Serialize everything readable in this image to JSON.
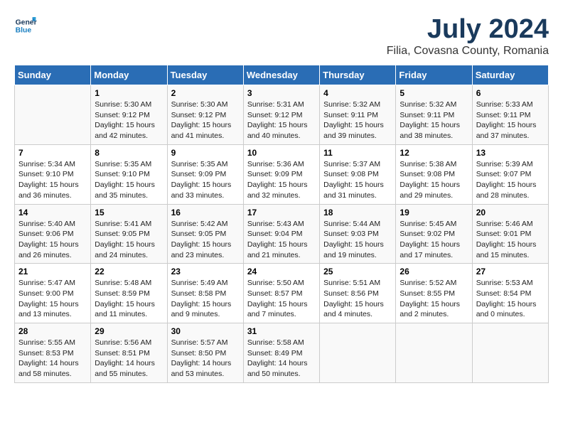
{
  "header": {
    "logo_line1": "General",
    "logo_line2": "Blue",
    "month_year": "July 2024",
    "location": "Filia, Covasna County, Romania"
  },
  "weekdays": [
    "Sunday",
    "Monday",
    "Tuesday",
    "Wednesday",
    "Thursday",
    "Friday",
    "Saturday"
  ],
  "weeks": [
    [
      {
        "day": "",
        "sunrise": "",
        "sunset": "",
        "daylight": ""
      },
      {
        "day": "1",
        "sunrise": "Sunrise: 5:30 AM",
        "sunset": "Sunset: 9:12 PM",
        "daylight": "Daylight: 15 hours and 42 minutes."
      },
      {
        "day": "2",
        "sunrise": "Sunrise: 5:30 AM",
        "sunset": "Sunset: 9:12 PM",
        "daylight": "Daylight: 15 hours and 41 minutes."
      },
      {
        "day": "3",
        "sunrise": "Sunrise: 5:31 AM",
        "sunset": "Sunset: 9:12 PM",
        "daylight": "Daylight: 15 hours and 40 minutes."
      },
      {
        "day": "4",
        "sunrise": "Sunrise: 5:32 AM",
        "sunset": "Sunset: 9:11 PM",
        "daylight": "Daylight: 15 hours and 39 minutes."
      },
      {
        "day": "5",
        "sunrise": "Sunrise: 5:32 AM",
        "sunset": "Sunset: 9:11 PM",
        "daylight": "Daylight: 15 hours and 38 minutes."
      },
      {
        "day": "6",
        "sunrise": "Sunrise: 5:33 AM",
        "sunset": "Sunset: 9:11 PM",
        "daylight": "Daylight: 15 hours and 37 minutes."
      }
    ],
    [
      {
        "day": "7",
        "sunrise": "Sunrise: 5:34 AM",
        "sunset": "Sunset: 9:10 PM",
        "daylight": "Daylight: 15 hours and 36 minutes."
      },
      {
        "day": "8",
        "sunrise": "Sunrise: 5:35 AM",
        "sunset": "Sunset: 9:10 PM",
        "daylight": "Daylight: 15 hours and 35 minutes."
      },
      {
        "day": "9",
        "sunrise": "Sunrise: 5:35 AM",
        "sunset": "Sunset: 9:09 PM",
        "daylight": "Daylight: 15 hours and 33 minutes."
      },
      {
        "day": "10",
        "sunrise": "Sunrise: 5:36 AM",
        "sunset": "Sunset: 9:09 PM",
        "daylight": "Daylight: 15 hours and 32 minutes."
      },
      {
        "day": "11",
        "sunrise": "Sunrise: 5:37 AM",
        "sunset": "Sunset: 9:08 PM",
        "daylight": "Daylight: 15 hours and 31 minutes."
      },
      {
        "day": "12",
        "sunrise": "Sunrise: 5:38 AM",
        "sunset": "Sunset: 9:08 PM",
        "daylight": "Daylight: 15 hours and 29 minutes."
      },
      {
        "day": "13",
        "sunrise": "Sunrise: 5:39 AM",
        "sunset": "Sunset: 9:07 PM",
        "daylight": "Daylight: 15 hours and 28 minutes."
      }
    ],
    [
      {
        "day": "14",
        "sunrise": "Sunrise: 5:40 AM",
        "sunset": "Sunset: 9:06 PM",
        "daylight": "Daylight: 15 hours and 26 minutes."
      },
      {
        "day": "15",
        "sunrise": "Sunrise: 5:41 AM",
        "sunset": "Sunset: 9:05 PM",
        "daylight": "Daylight: 15 hours and 24 minutes."
      },
      {
        "day": "16",
        "sunrise": "Sunrise: 5:42 AM",
        "sunset": "Sunset: 9:05 PM",
        "daylight": "Daylight: 15 hours and 23 minutes."
      },
      {
        "day": "17",
        "sunrise": "Sunrise: 5:43 AM",
        "sunset": "Sunset: 9:04 PM",
        "daylight": "Daylight: 15 hours and 21 minutes."
      },
      {
        "day": "18",
        "sunrise": "Sunrise: 5:44 AM",
        "sunset": "Sunset: 9:03 PM",
        "daylight": "Daylight: 15 hours and 19 minutes."
      },
      {
        "day": "19",
        "sunrise": "Sunrise: 5:45 AM",
        "sunset": "Sunset: 9:02 PM",
        "daylight": "Daylight: 15 hours and 17 minutes."
      },
      {
        "day": "20",
        "sunrise": "Sunrise: 5:46 AM",
        "sunset": "Sunset: 9:01 PM",
        "daylight": "Daylight: 15 hours and 15 minutes."
      }
    ],
    [
      {
        "day": "21",
        "sunrise": "Sunrise: 5:47 AM",
        "sunset": "Sunset: 9:00 PM",
        "daylight": "Daylight: 15 hours and 13 minutes."
      },
      {
        "day": "22",
        "sunrise": "Sunrise: 5:48 AM",
        "sunset": "Sunset: 8:59 PM",
        "daylight": "Daylight: 15 hours and 11 minutes."
      },
      {
        "day": "23",
        "sunrise": "Sunrise: 5:49 AM",
        "sunset": "Sunset: 8:58 PM",
        "daylight": "Daylight: 15 hours and 9 minutes."
      },
      {
        "day": "24",
        "sunrise": "Sunrise: 5:50 AM",
        "sunset": "Sunset: 8:57 PM",
        "daylight": "Daylight: 15 hours and 7 minutes."
      },
      {
        "day": "25",
        "sunrise": "Sunrise: 5:51 AM",
        "sunset": "Sunset: 8:56 PM",
        "daylight": "Daylight: 15 hours and 4 minutes."
      },
      {
        "day": "26",
        "sunrise": "Sunrise: 5:52 AM",
        "sunset": "Sunset: 8:55 PM",
        "daylight": "Daylight: 15 hours and 2 minutes."
      },
      {
        "day": "27",
        "sunrise": "Sunrise: 5:53 AM",
        "sunset": "Sunset: 8:54 PM",
        "daylight": "Daylight: 15 hours and 0 minutes."
      }
    ],
    [
      {
        "day": "28",
        "sunrise": "Sunrise: 5:55 AM",
        "sunset": "Sunset: 8:53 PM",
        "daylight": "Daylight: 14 hours and 58 minutes."
      },
      {
        "day": "29",
        "sunrise": "Sunrise: 5:56 AM",
        "sunset": "Sunset: 8:51 PM",
        "daylight": "Daylight: 14 hours and 55 minutes."
      },
      {
        "day": "30",
        "sunrise": "Sunrise: 5:57 AM",
        "sunset": "Sunset: 8:50 PM",
        "daylight": "Daylight: 14 hours and 53 minutes."
      },
      {
        "day": "31",
        "sunrise": "Sunrise: 5:58 AM",
        "sunset": "Sunset: 8:49 PM",
        "daylight": "Daylight: 14 hours and 50 minutes."
      },
      {
        "day": "",
        "sunrise": "",
        "sunset": "",
        "daylight": ""
      },
      {
        "day": "",
        "sunrise": "",
        "sunset": "",
        "daylight": ""
      },
      {
        "day": "",
        "sunrise": "",
        "sunset": "",
        "daylight": ""
      }
    ]
  ]
}
